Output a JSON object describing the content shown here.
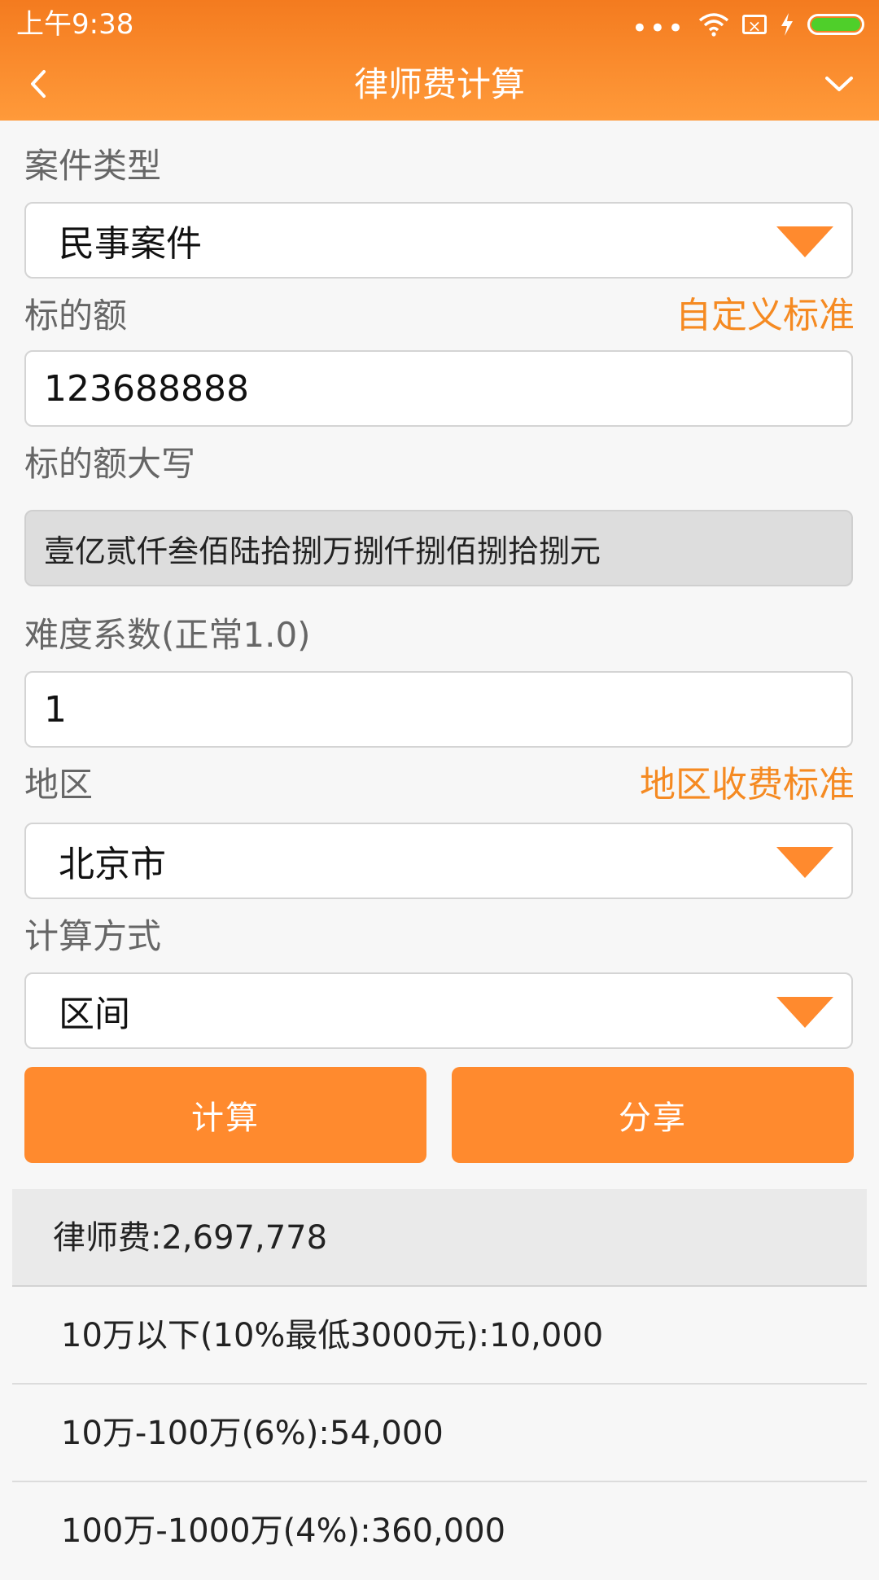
{
  "status_bar": {
    "time": "上午9:38",
    "dots": "•••"
  },
  "header": {
    "title": "律师费计算"
  },
  "form": {
    "case_type": {
      "label": "案件类型",
      "value": "民事案件"
    },
    "amount": {
      "label": "标的额",
      "custom_standard_link": "自定义标准",
      "value": "123688888"
    },
    "amount_uppercase": {
      "label": "标的额大写",
      "value": "壹亿贰仟叁佰陆拾捌万捌仟捌佰捌拾捌元"
    },
    "difficulty": {
      "label": "难度系数(正常1.0)",
      "value": "1"
    },
    "region": {
      "label": "地区",
      "standard_link": "地区收费标准",
      "value": "北京市"
    },
    "calc_method": {
      "label": "计算方式",
      "value": "区间"
    }
  },
  "buttons": {
    "calculate": "计算",
    "share": "分享"
  },
  "results": {
    "total": "律师费:2,697,778",
    "rows": [
      "10万以下(10%最低3000元):10,000",
      "10万-100万(6%):54,000",
      "100万-1000万(4%):360,000"
    ]
  },
  "colors": {
    "accent": "#ff8a2e",
    "header_top": "#f47b1f",
    "link": "#f58a22"
  }
}
